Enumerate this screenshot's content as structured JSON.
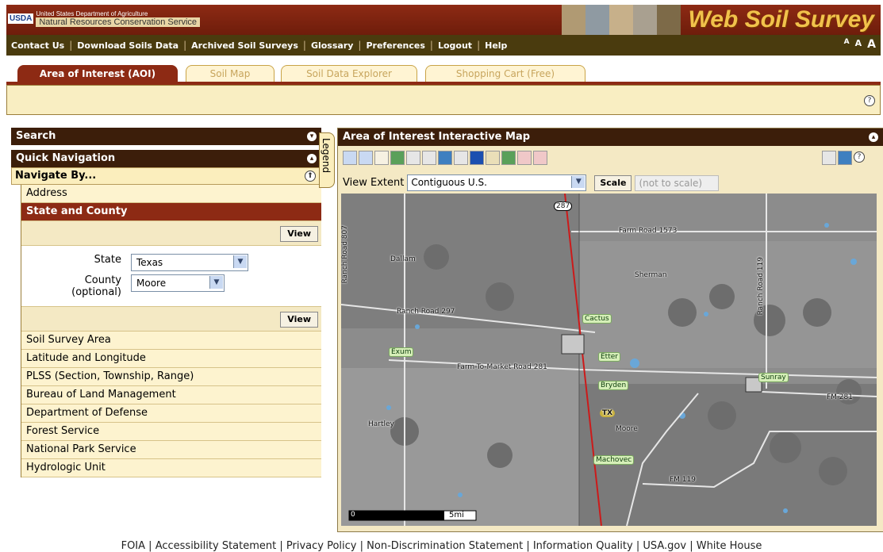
{
  "header": {
    "usda_logo": "USDA",
    "agency_top": "United States Department of Agriculture",
    "agency_name": "Natural Resources Conservation Service",
    "brand": "Web Soil Survey"
  },
  "topnav": {
    "items": [
      "Contact Us",
      "Download Soils Data",
      "Archived Soil Surveys",
      "Glossary",
      "Preferences",
      "Logout",
      "Help"
    ],
    "font_sizes": [
      "A",
      "A",
      "A"
    ]
  },
  "tabs": [
    "Area of Interest (AOI)",
    "Soil Map",
    "Soil Data Explorer",
    "Shopping Cart (Free)"
  ],
  "left": {
    "search": "Search",
    "quick_nav": "Quick Navigation",
    "navigate_by": "Navigate By...",
    "items": {
      "address": "Address",
      "state_county": "State and County",
      "soil_survey_area": "Soil Survey Area",
      "lat_long": "Latitude and Longitude",
      "plss": "PLSS (Section, Township, Range)",
      "blm": "Bureau of Land Management",
      "dod": "Department of Defense",
      "forest": "Forest Service",
      "nps": "National Park Service",
      "huc": "Hydrologic Unit"
    },
    "view_label": "View",
    "state_label": "State",
    "state_value": "Texas",
    "county_label": "County",
    "county_optional": "(optional)",
    "county_value": "Moore"
  },
  "legend_tab": "Legend",
  "map": {
    "title": "Area of Interest Interactive Map",
    "view_extent_label": "View Extent",
    "view_extent_value": "Contiguous U.S.",
    "scale_label": "Scale",
    "scale_value": "(not to scale)",
    "scale_bar": "5mi",
    "scale_zero": "0",
    "labels": {
      "route287": "287",
      "farm1573": "Farm Road 1573",
      "ranch807": "Ranch Road 807",
      "dallam": "Dallam",
      "sherman": "Sherman",
      "ranch119": "Ranch Road 119",
      "ranch297": "Ranch Road 297",
      "cactus": "Cactus",
      "exum": "Exum",
      "etter": "Etter",
      "fm281road": "Farm-To-Market Road 281",
      "sunray": "Sunray",
      "bryden": "Bryden",
      "fm281": "FM 281",
      "tx": "TX",
      "hartley": "Hartley",
      "moore": "Moore",
      "machovec": "Machovec",
      "fm119": "FM 119"
    }
  },
  "footer": {
    "links": [
      "FOIA",
      "Accessibility Statement",
      "Privacy Policy",
      "Non-Discrimination Statement",
      "Information Quality",
      "USA.gov",
      "White House"
    ]
  }
}
